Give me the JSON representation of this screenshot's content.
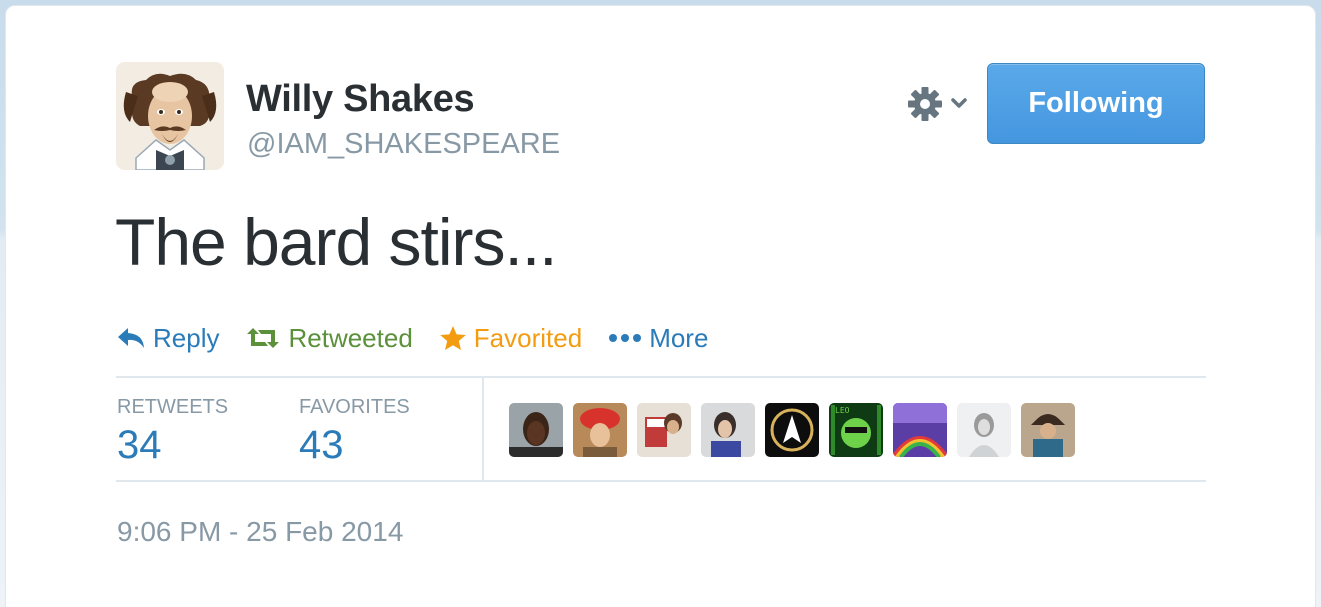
{
  "user": {
    "name": "Willy Shakes",
    "handle": "@IAM_SHAKESPEARE",
    "avatar_icon": "shakespeare-portrait-avatar"
  },
  "header": {
    "settings_icon": "gear-icon",
    "dropdown_icon": "chevron-down-icon",
    "follow_label": "Following",
    "follow_color": "#4a9ee5"
  },
  "tweet": {
    "text": "The bard stirs..."
  },
  "actions": {
    "reply_label": "Reply",
    "retweet_label": "Retweeted",
    "favorite_label": "Favorited",
    "more_label": "More",
    "reply_color": "#2b7bb9",
    "retweet_color": "#5c913b",
    "favorite_color": "#f39c12"
  },
  "stats": {
    "retweets_label": "RETWEETS",
    "retweets_count": "34",
    "favorites_label": "FAVORITES",
    "favorites_count": "43"
  },
  "favoriters": [
    {
      "avatar": "favoriter-avatar-1"
    },
    {
      "avatar": "favoriter-avatar-2"
    },
    {
      "avatar": "favoriter-avatar-3"
    },
    {
      "avatar": "favoriter-avatar-4"
    },
    {
      "avatar": "favoriter-avatar-5"
    },
    {
      "avatar": "favoriter-avatar-6"
    },
    {
      "avatar": "favoriter-avatar-7"
    },
    {
      "avatar": "favoriter-avatar-8"
    },
    {
      "avatar": "favoriter-avatar-9"
    }
  ],
  "timestamp": "9:06 PM - 25 Feb 2014"
}
